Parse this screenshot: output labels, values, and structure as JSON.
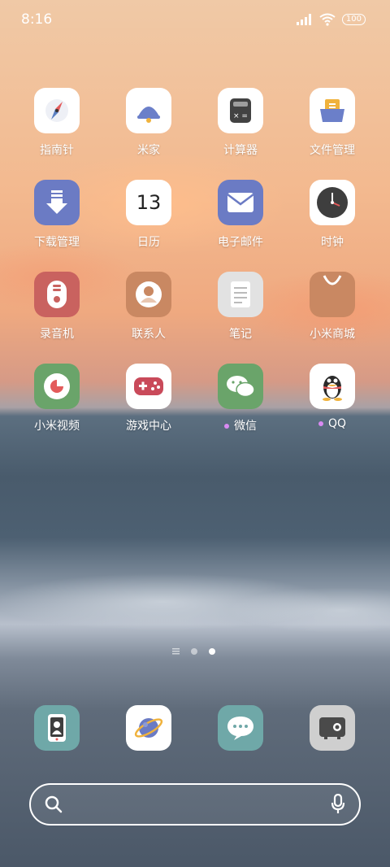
{
  "status_bar": {
    "time": "8:16",
    "battery": "100"
  },
  "apps": [
    {
      "label": "指南针"
    },
    {
      "label": "米家"
    },
    {
      "label": "计算器"
    },
    {
      "label": "文件管理"
    },
    {
      "label": "下载管理"
    },
    {
      "label": "日历",
      "date": "13"
    },
    {
      "label": "电子邮件"
    },
    {
      "label": "时钟"
    },
    {
      "label": "录音机"
    },
    {
      "label": "联系人"
    },
    {
      "label": "笔记"
    },
    {
      "label": "小米商城"
    },
    {
      "label": "小米视频"
    },
    {
      "label": "游戏中心"
    },
    {
      "label": "微信"
    },
    {
      "label": "QQ"
    }
  ],
  "dock": [
    {
      "icon": "phone-manager-icon"
    },
    {
      "icon": "browser-icon"
    },
    {
      "icon": "messages-icon"
    },
    {
      "icon": "wallet-icon"
    }
  ],
  "colors": {
    "accent_dot": "#d98af2"
  }
}
